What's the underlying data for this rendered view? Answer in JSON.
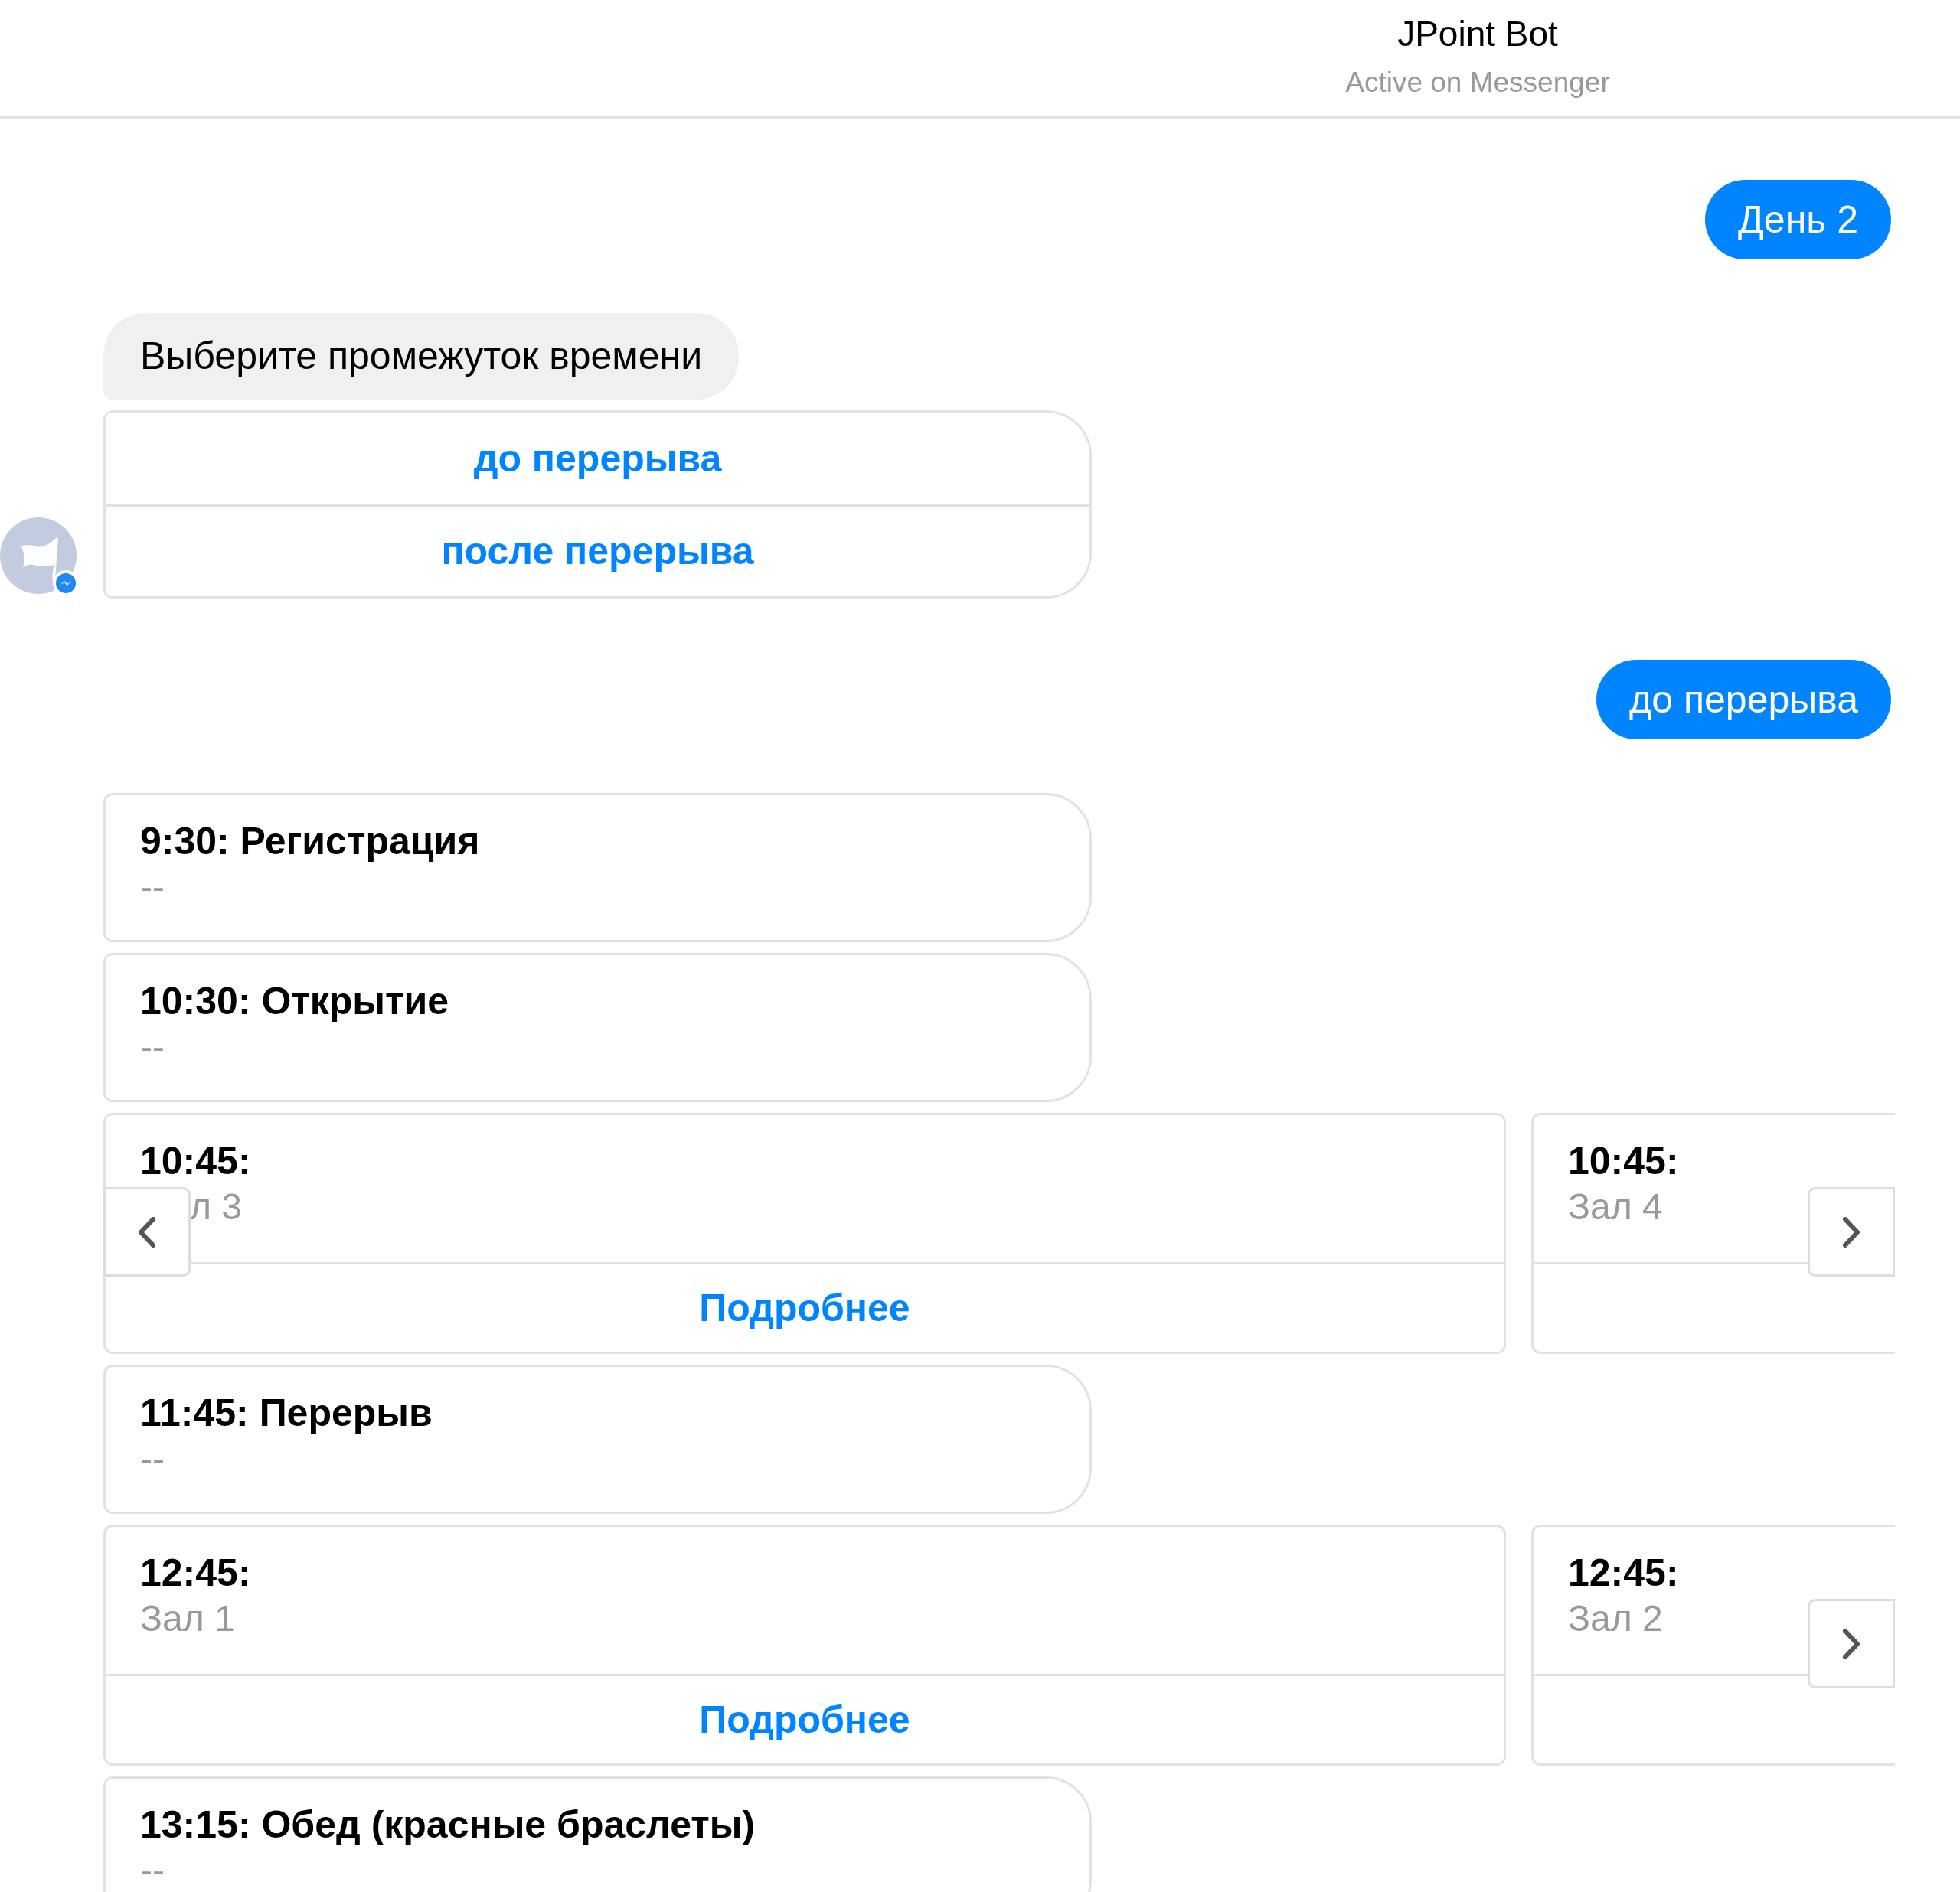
{
  "header": {
    "title": "JPoint Bot",
    "status": "Active on Messenger"
  },
  "messages": [
    {
      "kind": "user",
      "text": "День 2"
    },
    {
      "kind": "bot",
      "avatar": true,
      "items": [
        {
          "kind": "text",
          "text": "Выберите промежуток времени"
        },
        {
          "kind": "quick_replies",
          "options": [
            "до перерыва",
            "после перерыва"
          ]
        }
      ]
    },
    {
      "kind": "user",
      "text": "до перерыва"
    },
    {
      "kind": "bot",
      "avatar": false,
      "items": [
        {
          "kind": "card",
          "title": "9:30: Регистрация",
          "subtitle": "--"
        },
        {
          "kind": "card",
          "title": "10:30: Открытие",
          "subtitle": "--"
        },
        {
          "kind": "carousel",
          "prev_arrow": true,
          "next_arrow": true,
          "cards": [
            {
              "title": "10:45:",
              "subtitle": "л 3",
              "button": "Подробнее"
            },
            {
              "title": "10:45:",
              "subtitle": "Зал 4"
            }
          ]
        },
        {
          "kind": "card",
          "title": "11:45: Перерыв",
          "subtitle": "--"
        },
        {
          "kind": "carousel",
          "prev_arrow": false,
          "next_arrow": true,
          "cards": [
            {
              "title": "12:45:",
              "subtitle": "Зал 1",
              "button": "Подробнее"
            },
            {
              "title": "12:45:",
              "subtitle": "Зал 2"
            }
          ]
        },
        {
          "kind": "card",
          "title": "13:15: Обед (красные браслеты)",
          "subtitle": "--"
        }
      ]
    }
  ]
}
